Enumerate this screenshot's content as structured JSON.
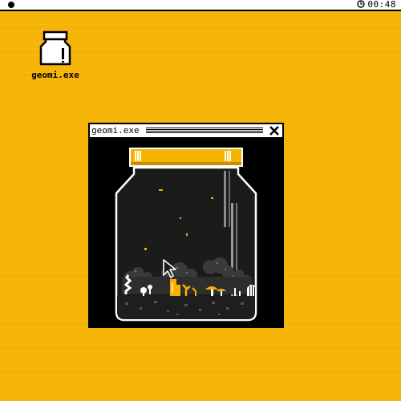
{
  "menubar": {
    "clock_time": "00:48",
    "icons": {
      "menu": "menu-dot-icon",
      "clock": "clock-icon"
    }
  },
  "desktop": {
    "icon_label": "geomi.exe",
    "icon": "jar-icon"
  },
  "window": {
    "title": "geomi.exe",
    "close_icon": "close-x-icon"
  },
  "terrarium": {
    "lid_color": "#f6b200",
    "glass_color": "#ffffff",
    "soil_color": "#1e1e1e",
    "glow_color": "#f6b200",
    "cursor_icon": "arrow-cursor-icon"
  },
  "colors": {
    "desktop": "#f6b200",
    "menubar": "#ffffff",
    "window_border": "#000000",
    "accent": "#f6b200"
  }
}
